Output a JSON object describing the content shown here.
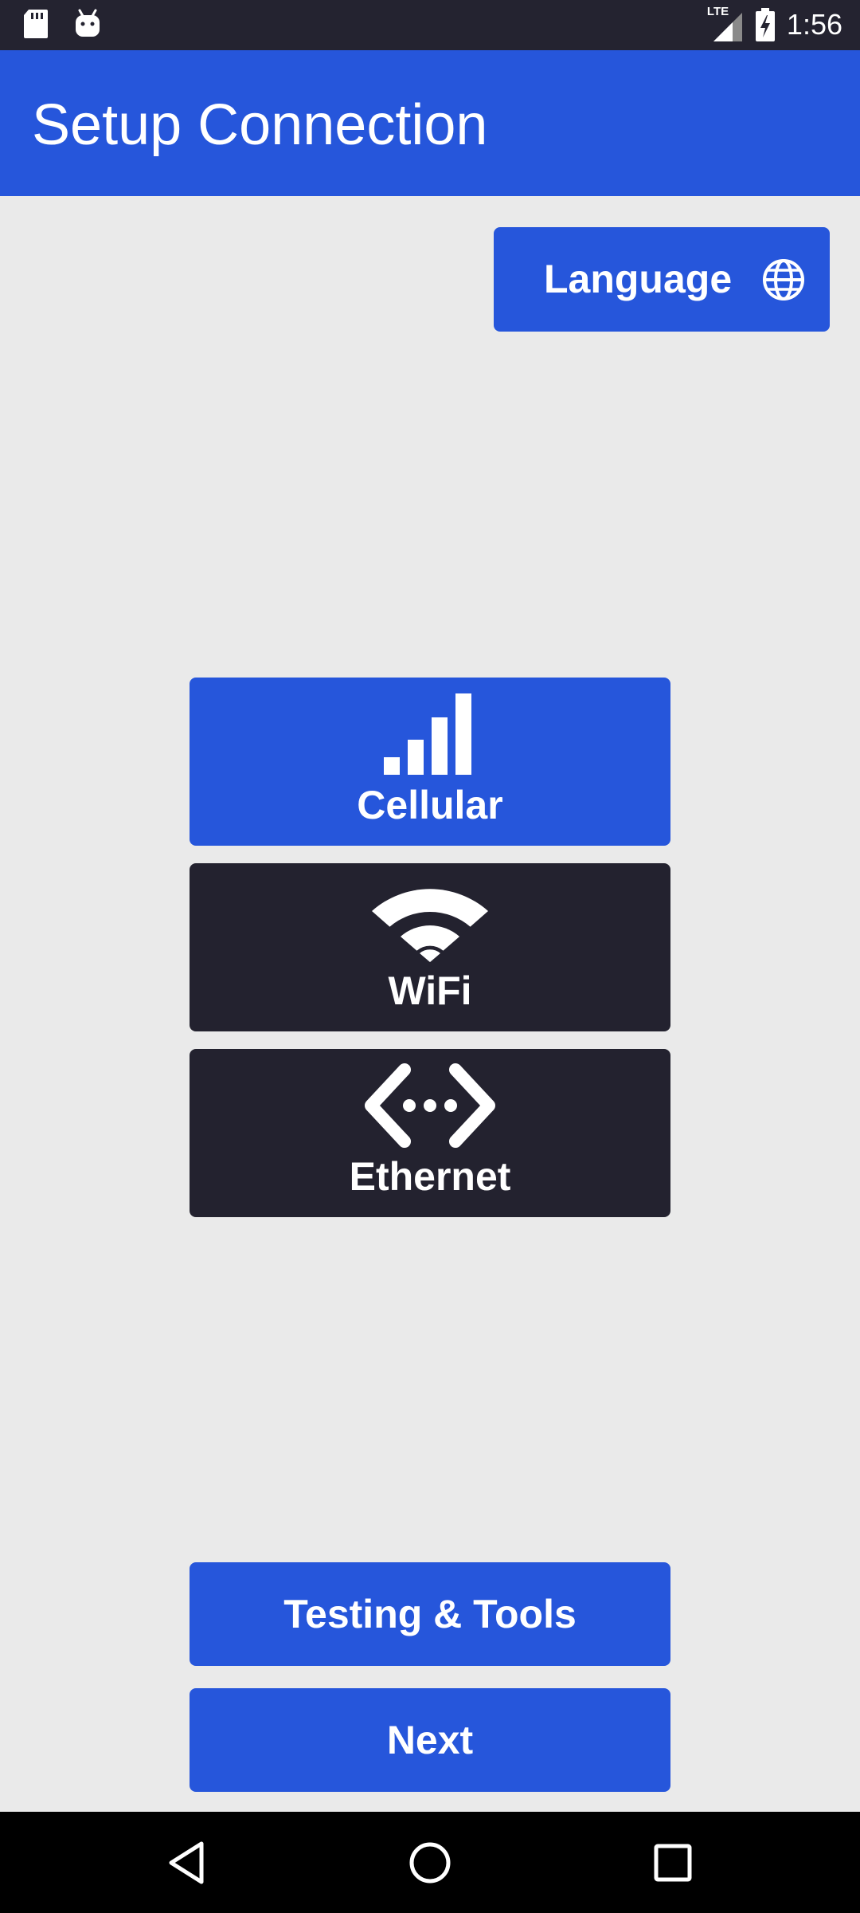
{
  "status_bar": {
    "time": "1:56",
    "network_label": "LTE",
    "icons": [
      "sd-card-icon",
      "android-debug-icon",
      "lte-signal-icon",
      "battery-charging-icon"
    ]
  },
  "app_bar": {
    "title": "Setup Connection"
  },
  "language_button": {
    "label": "Language",
    "icon": "globe-icon"
  },
  "connection_options": [
    {
      "label": "Cellular",
      "icon": "cellular-signal-icon",
      "selected": true
    },
    {
      "label": "WiFi",
      "icon": "wifi-icon",
      "selected": false
    },
    {
      "label": "Ethernet",
      "icon": "ethernet-icon",
      "selected": false
    }
  ],
  "footer_buttons": {
    "tools_label": "Testing & Tools",
    "next_label": "Next"
  },
  "nav_bar": {
    "icons": [
      "back-icon",
      "home-icon",
      "recents-icon"
    ]
  },
  "colors": {
    "primary": "#2656db",
    "dark": "#23222f",
    "background": "#eaeaea",
    "status_bar": "#242330"
  }
}
